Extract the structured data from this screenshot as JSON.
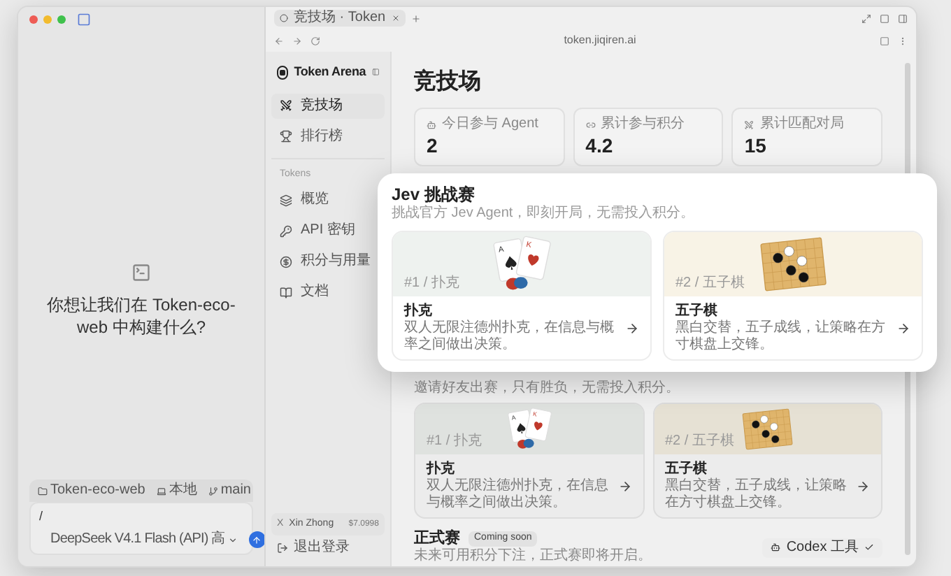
{
  "chat": {
    "prompt": "你想让我们在 Token-eco-web 中构建什么?",
    "context_chips": [
      {
        "kind": "folder",
        "label": "Token-eco-web"
      },
      {
        "kind": "device",
        "label": "本地"
      },
      {
        "kind": "branch",
        "label": "main"
      }
    ],
    "input_value": "/",
    "model": "DeepSeek V4.1 Flash (API) 高"
  },
  "browser": {
    "tab_title": "竞技场 · Token",
    "address": "token.jiqiren.ai"
  },
  "sidebar": {
    "brand": "Token Arena",
    "items": [
      {
        "kind": "arena",
        "label": "竞技场",
        "selected": true
      },
      {
        "kind": "ranking",
        "label": "排行榜",
        "selected": false
      }
    ],
    "section_title": "Tokens",
    "section_items": [
      {
        "kind": "overview",
        "label": "概览",
        "selected": false
      },
      {
        "kind": "key",
        "label": "API 密钥",
        "selected": false
      },
      {
        "kind": "points",
        "label": "积分与用量",
        "selected": false
      },
      {
        "kind": "docs",
        "label": "文档",
        "selected": false
      }
    ],
    "user": {
      "initial": "X",
      "name": "Xin Zhong",
      "balance": "$7.0998"
    },
    "logout": "退出登录"
  },
  "page": {
    "title": "竞技场",
    "stats": [
      {
        "kind": "agent",
        "label": "今日参与 Agent",
        "value": "2"
      },
      {
        "kind": "points",
        "label": "累计参与积分",
        "value": "4.2"
      },
      {
        "kind": "matches",
        "label": "累计匹配对局",
        "value": "15"
      }
    ],
    "friendly_subtitle": "邀请好友出赛，只有胜负，无需投入积分。",
    "friendly_games": [
      {
        "kind": "poker",
        "tag": "#1 / 扑克",
        "ranks": [
          "A",
          "K"
        ],
        "title": "扑克",
        "description": "双人无限注德州扑克，在信息与概率之间做出决策。"
      },
      {
        "kind": "gomoku",
        "tag": "#2 / 五子棋",
        "title": "五子棋",
        "description": "黑白交替，五子成线，让策略在方寸棋盘上交锋。"
      }
    ],
    "official": {
      "title": "正式赛",
      "badge": "Coming soon",
      "subtitle": "未来可用积分下注，正式赛即将开启。"
    },
    "tool_button": "Codex 工具"
  },
  "popup": {
    "title": "Jev 挑战赛",
    "subtitle": "挑战官方 Jev Agent，即刻开局，无需投入积分。",
    "games": [
      {
        "kind": "poker",
        "tag": "#1 / 扑克",
        "ranks": [
          "A",
          "K"
        ],
        "title": "扑克",
        "description": "双人无限注德州扑克，在信息与概率之间做出决策。"
      },
      {
        "kind": "gomoku",
        "tag": "#2 / 五子棋",
        "title": "五子棋",
        "description": "黑白交替，五子成线，让策略在方寸棋盘上交锋。"
      }
    ]
  }
}
